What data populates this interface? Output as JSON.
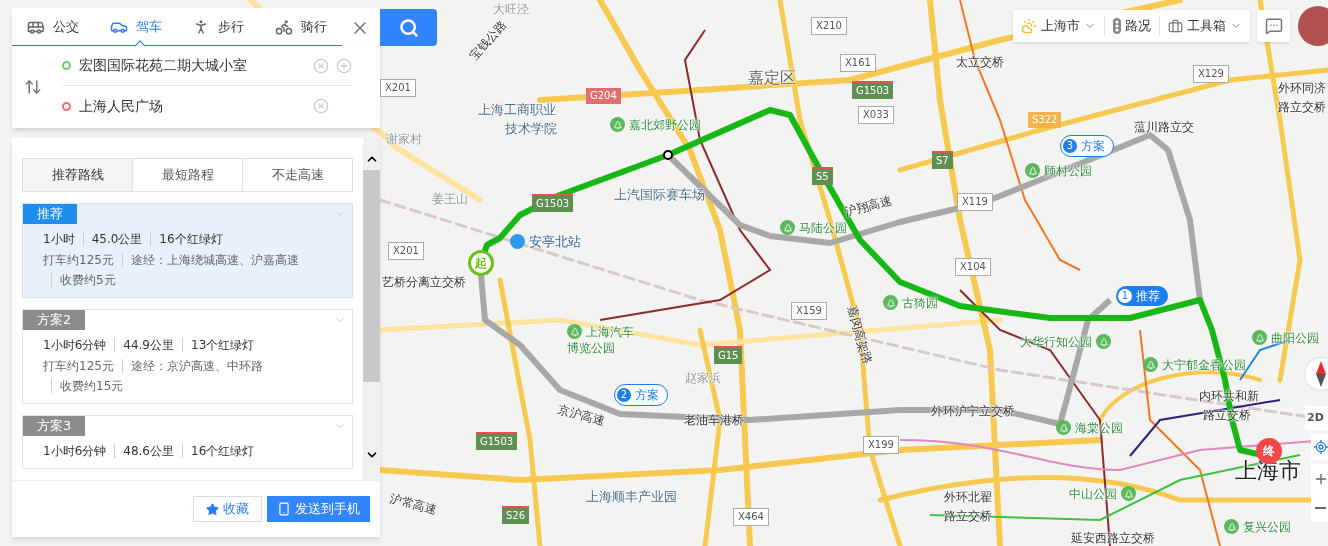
{
  "search_panel": {
    "modes": [
      {
        "label": "公交",
        "kind": "bus",
        "selected": false
      },
      {
        "label": "驾车",
        "kind": "car",
        "selected": true
      },
      {
        "label": "步行",
        "kind": "walk",
        "selected": false
      },
      {
        "label": "骑行",
        "kind": "bike",
        "selected": false
      }
    ],
    "start": {
      "value": "宏图国际花苑二期大城小室"
    },
    "end": {
      "value": "上海人民广场"
    }
  },
  "route_panel": {
    "options": [
      {
        "label": "推荐路线",
        "selected": true
      },
      {
        "label": "最短路程",
        "selected": false
      },
      {
        "label": "不走高速",
        "selected": false
      }
    ],
    "routes": [
      {
        "tag": "推荐",
        "selected": true,
        "stats": [
          "1小时",
          "45.0公里",
          "16个红绿灯"
        ],
        "details": [
          "打车约125元",
          "途经：上海绕城高速、沪嘉高速",
          "收费约5元"
        ]
      },
      {
        "tag": "方案2",
        "selected": false,
        "stats": [
          "1小时6分钟",
          "44.9公里",
          "13个红绿灯"
        ],
        "details": [
          "打车约125元",
          "途经：京沪高速、中环路",
          "收费约15元"
        ]
      },
      {
        "tag": "方案3",
        "selected": false,
        "stats": [
          "1小时6分钟",
          "48.6公里",
          "16个红绿灯"
        ]
      }
    ],
    "footer": {
      "favorite": "收藏",
      "send": "发送到手机"
    }
  },
  "toolbar": {
    "city": "上海市",
    "traffic": "路况",
    "tools": "工具箱"
  },
  "map": {
    "labels": [
      {
        "text": "大旺泾",
        "kind": "place"
      },
      {
        "text": "宝钱公路",
        "kind": "road"
      },
      {
        "text": "谢家村",
        "kind": "place"
      },
      {
        "text": "上海工商职业",
        "kind": "poi"
      },
      {
        "text": "技术学院",
        "kind": "poi"
      },
      {
        "text": "嘉北郊野公园",
        "kind": "park"
      },
      {
        "text": "嘉定区",
        "kind": "district"
      },
      {
        "text": "姜王山",
        "kind": "place"
      },
      {
        "text": "上汽国际赛车场",
        "kind": "poi"
      },
      {
        "text": "安亭北站",
        "kind": "station"
      },
      {
        "text": "太立交桥",
        "kind": "road"
      },
      {
        "text": "蕰川路立交",
        "kind": "road"
      },
      {
        "text": "顾村公园",
        "kind": "park"
      },
      {
        "text": "沪翔高速",
        "kind": "road"
      },
      {
        "text": "马陆公园",
        "kind": "park"
      },
      {
        "text": "外环同济",
        "kind": "road"
      },
      {
        "text": "路立交桥",
        "kind": "road"
      },
      {
        "text": "嘉闵高架路",
        "kind": "road"
      },
      {
        "text": "古猗园",
        "kind": "park"
      },
      {
        "text": "上海汽车",
        "kind": "park"
      },
      {
        "text": "博览公园",
        "kind": "park"
      },
      {
        "text": "大华行知公园",
        "kind": "park"
      },
      {
        "text": "大宁郁金香公园",
        "kind": "park"
      },
      {
        "text": "曲阳公园",
        "kind": "park"
      },
      {
        "text": "赵家浜",
        "kind": "place"
      },
      {
        "text": "京沪高速",
        "kind": "road"
      },
      {
        "text": "老油车港桥",
        "kind": "road"
      },
      {
        "text": "外环沪宁立交桥",
        "kind": "road"
      },
      {
        "text": "海棠公园",
        "kind": "park"
      },
      {
        "text": "内环共和新",
        "kind": "road"
      },
      {
        "text": "路立交桥",
        "kind": "road"
      },
      {
        "text": "上海市",
        "kind": "city"
      },
      {
        "text": "沪常高速",
        "kind": "road"
      },
      {
        "text": "上海顺丰产业园",
        "kind": "poi"
      },
      {
        "text": "外环北翟",
        "kind": "road"
      },
      {
        "text": "中山公园",
        "kind": "park"
      },
      {
        "text": "路立交桥",
        "kind": "road"
      },
      {
        "text": "复兴公园",
        "kind": "park"
      },
      {
        "text": "延安西路立交桥",
        "kind": "road"
      },
      {
        "text": "艺桥分离立交桥",
        "kind": "road"
      }
    ],
    "shields": [
      {
        "text": "X210",
        "kind": "county"
      },
      {
        "text": "X161",
        "kind": "county"
      },
      {
        "text": "G1503",
        "kind": "expressway"
      },
      {
        "text": "X033",
        "kind": "county"
      },
      {
        "text": "G204",
        "kind": "national"
      },
      {
        "text": "S5",
        "kind": "expressway"
      },
      {
        "text": "S7",
        "kind": "expressway"
      },
      {
        "text": "G1503",
        "kind": "expressway"
      },
      {
        "text": "X201",
        "kind": "county"
      },
      {
        "text": "X201",
        "kind": "county"
      },
      {
        "text": "X119",
        "kind": "county"
      },
      {
        "text": "X104",
        "kind": "county"
      },
      {
        "text": "X129",
        "kind": "county"
      },
      {
        "text": "S322",
        "kind": "provincial"
      },
      {
        "text": "X159",
        "kind": "county"
      },
      {
        "text": "G15",
        "kind": "expressway"
      },
      {
        "text": "X199",
        "kind": "county"
      },
      {
        "text": "G1503",
        "kind": "expressway"
      },
      {
        "text": "S26",
        "kind": "expressway"
      },
      {
        "text": "X464",
        "kind": "county"
      }
    ],
    "route_markers": [
      {
        "number": "1",
        "label": "推荐",
        "selected": true
      },
      {
        "number": "2",
        "label": "方案",
        "selected": false
      },
      {
        "number": "3",
        "label": "方案",
        "selected": false
      }
    ],
    "start_marker": "起",
    "end_marker": "终",
    "view_toggle": "2D"
  }
}
